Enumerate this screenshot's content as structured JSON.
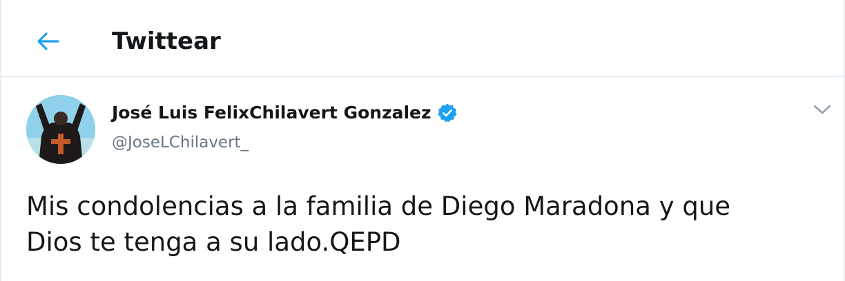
{
  "header": {
    "title": "Twittear",
    "back_icon": "arrow-left-icon",
    "accent_color": "#1da1f2"
  },
  "tweet": {
    "display_name": "José Luis FelixChilavert Gonzalez",
    "handle": "@JoseLChilavert_",
    "verified": true,
    "verified_icon": "verified-badge-icon",
    "verified_color": "#1da1f2",
    "menu_icon": "chevron-down-icon",
    "text_lines": [
      "Mis condolencias a la familia de Diego Maradona y que",
      "Dios te tenga a su lado.QEPD"
    ]
  }
}
